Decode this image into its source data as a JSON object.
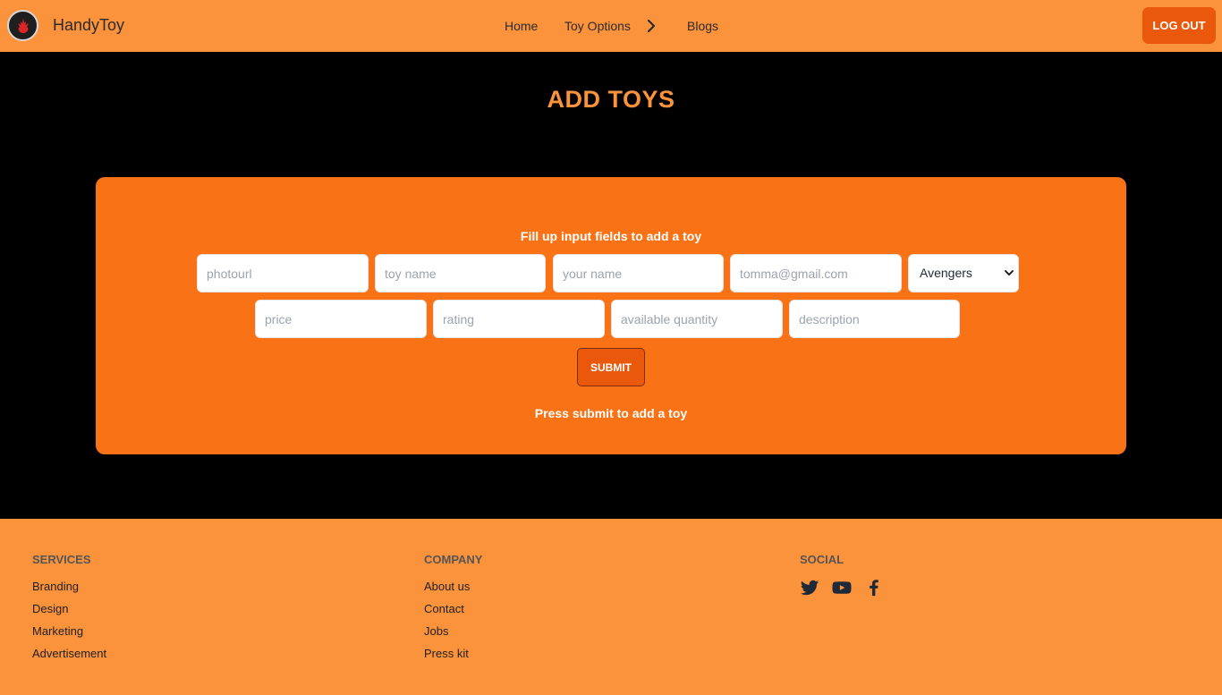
{
  "navbar": {
    "brand": "HandyToy",
    "links": {
      "home": "Home",
      "toy_options": "Toy Options",
      "blogs": "Blogs"
    },
    "logout_label": "LOG OUT"
  },
  "main": {
    "title": "ADD TOYS",
    "form": {
      "heading": "Fill up input fields to add a toy",
      "placeholders": {
        "photourl": "photourl",
        "toy_name": "toy name",
        "your_name": "your name",
        "email": "tomma@gmail.com",
        "price": "price",
        "rating": "rating",
        "available_quantity": "available quantity",
        "description": "description"
      },
      "category_selected": "Avengers",
      "submit_label": "SUBMIT",
      "footer_text": "Press submit to add a toy"
    }
  },
  "footer": {
    "services": {
      "heading": "SERVICES",
      "links": [
        "Branding",
        "Design",
        "Marketing",
        "Advertisement"
      ]
    },
    "company": {
      "heading": "COMPANY",
      "links": [
        "About us",
        "Contact",
        "Jobs",
        "Press kit"
      ]
    },
    "social": {
      "heading": "SOCIAL",
      "icons": [
        "twitter-icon",
        "youtube-icon",
        "facebook-icon"
      ]
    }
  },
  "colors": {
    "navbar_bg": "#fb923c",
    "accent": "#f97316",
    "button": "#ea580c",
    "page_bg": "#000000"
  }
}
